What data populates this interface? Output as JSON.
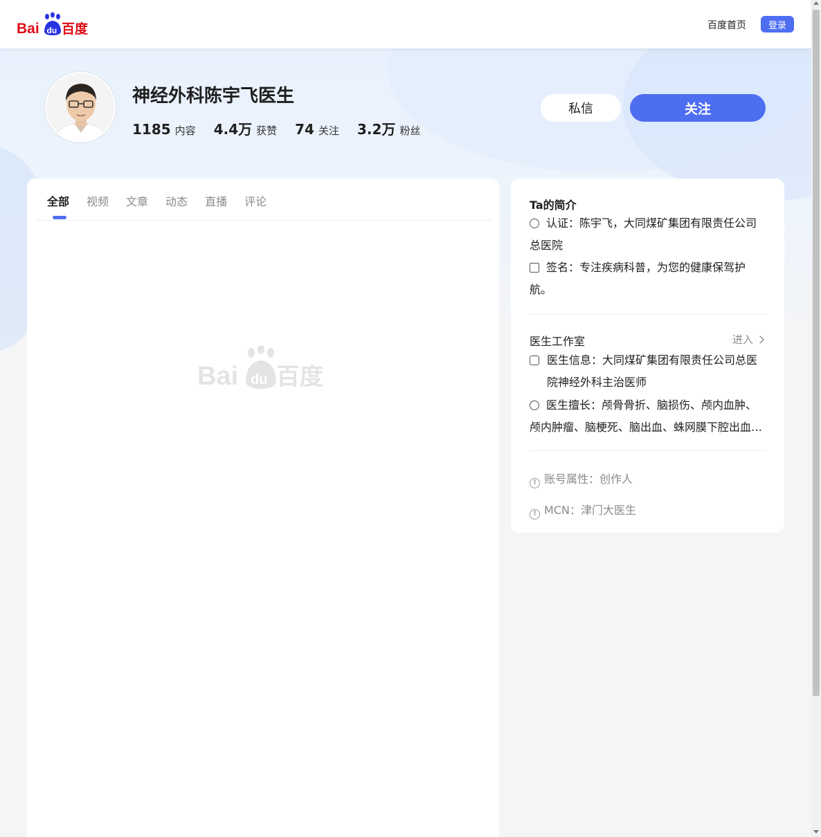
{
  "header": {
    "logo_text": "Bai百度",
    "home_link": "百度首页",
    "login_label": "登录"
  },
  "profile": {
    "name": "神经外科陈宇飞医生",
    "stats": [
      {
        "num": "1185",
        "label": "内容"
      },
      {
        "num": "4.4万",
        "label": "获赞"
      },
      {
        "num": "74",
        "label": "关注"
      },
      {
        "num": "3.2万",
        "label": "粉丝"
      }
    ],
    "message_label": "私信",
    "follow_label": "关注"
  },
  "tabs": [
    {
      "label": "全部",
      "active": true
    },
    {
      "label": "视频",
      "active": false
    },
    {
      "label": "文章",
      "active": false
    },
    {
      "label": "动态",
      "active": false
    },
    {
      "label": "直播",
      "active": false
    },
    {
      "label": "评论",
      "active": false
    }
  ],
  "intro": {
    "title": "Ta的简介",
    "cert": "认证：陈宇飞，大同煤矿集团有限责任公司总医院",
    "signature": "签名：专注疾病科普，为您的健康保驾护航。"
  },
  "studio": {
    "title": "医生工作室",
    "enter_label": "进入",
    "info": "医生信息：大同煤矿集团有限责任公司总医院神经外科主治医师",
    "specialty": "医生擅长：颅骨骨折、脑损伤、颅内血肿、颅内肿瘤、脑梗死、脑出血、蛛网膜下腔出血…"
  },
  "account": {
    "type": "账号属性：创作人",
    "mcn": "MCN：津门大医生"
  },
  "colors": {
    "accent": "#4e6ef2",
    "baidu_red": "#de0b15",
    "baidu_blue": "#2932e1"
  }
}
